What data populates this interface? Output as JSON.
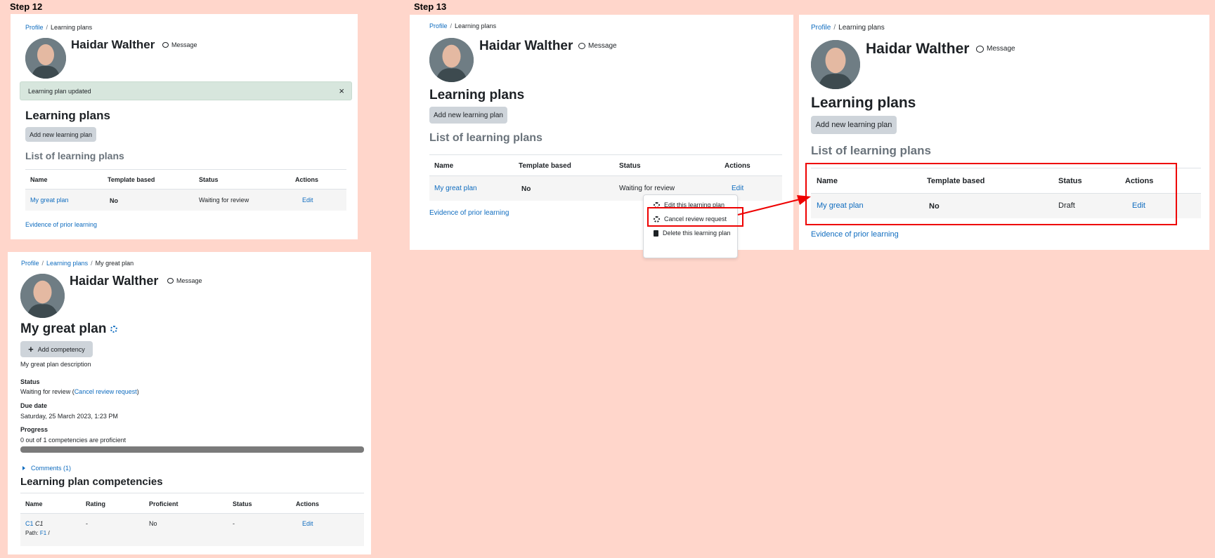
{
  "steps": {
    "s12": "Step 12",
    "s13": "Step 13"
  },
  "user": {
    "name": "Haidar Walther",
    "message": "Message"
  },
  "breadcrumb": {
    "profile": "Profile",
    "learning_plans": "Learning plans",
    "plan": "My great plan"
  },
  "learning_plans_page": {
    "title": "Learning plans",
    "add_button": "Add new learning plan",
    "list_heading": "List of learning plans",
    "columns": {
      "name": "Name",
      "template": "Template based",
      "status": "Status",
      "actions": "Actions"
    },
    "plan_name": "My great plan",
    "template_value": "No",
    "status_waiting": "Waiting for review",
    "status_draft": "Draft",
    "edit": "Edit",
    "evidence_link": "Evidence of prior learning"
  },
  "alert": {
    "text": "Learning plan updated",
    "close": "×"
  },
  "action_menu": {
    "edit": "Edit this learning plan",
    "cancel": "Cancel review request",
    "delete": "Delete this learning plan"
  },
  "plan_page": {
    "title": "My great plan",
    "add_competency": "Add competency",
    "description": "My great plan description",
    "status_label": "Status",
    "status_value": "Waiting for review (",
    "cancel_link": "Cancel review request",
    "status_close": ")",
    "due_label": "Due date",
    "due_value": "Saturday, 25 March 2023, 1:23 PM",
    "progress_label": "Progress",
    "progress_text": "0 out of 1 competencies are proficient",
    "progress_fraction": 0,
    "comments": "Comments (1)",
    "competencies_heading": "Learning plan competencies",
    "comp_columns": {
      "name": "Name",
      "rating": "Rating",
      "proficient": "Proficient",
      "status": "Status",
      "actions": "Actions"
    },
    "comp_row": {
      "id": "C1",
      "name": "C1",
      "rating": "-",
      "proficient": "No",
      "status": "-",
      "edit": "Edit",
      "path_label": "Path:",
      "path_link": "F1",
      "path_sep": "/"
    }
  },
  "colors": {
    "background": "#ffd6cb",
    "link": "#0f6cbf",
    "highlight": "#ee0000",
    "alert_bg": "#d7e6dd"
  }
}
